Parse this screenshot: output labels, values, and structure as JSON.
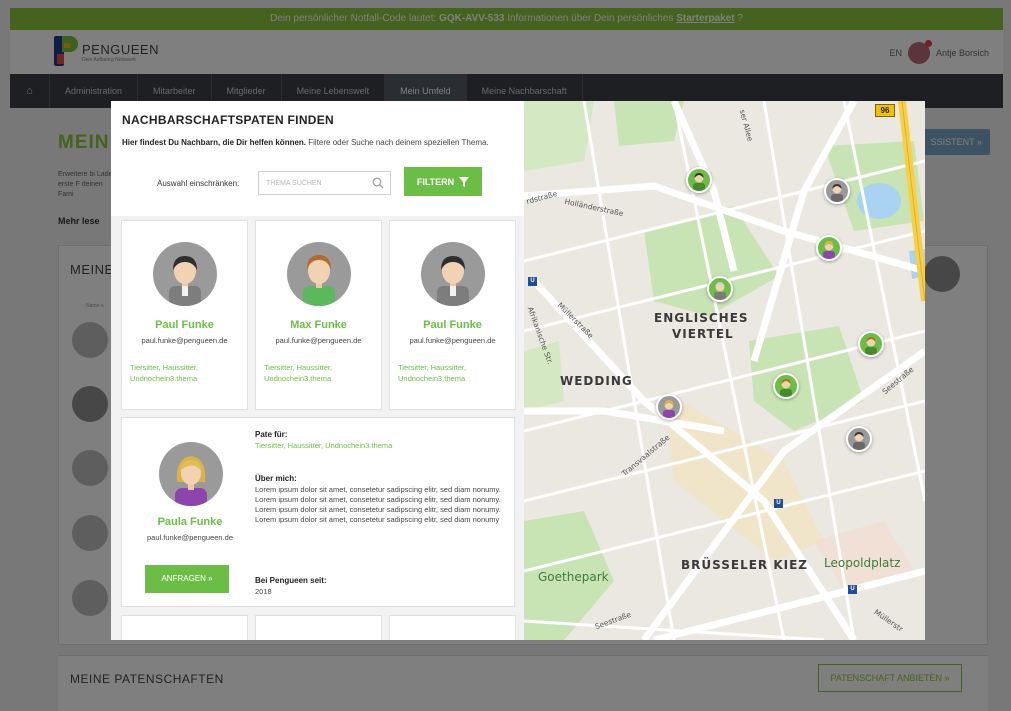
{
  "banner": {
    "prefix": "Dein persönlicher Notfall-Code lautet:",
    "code": "GQK-AVV-533",
    "middle": "Informationen über Dein persönliches",
    "link": "Starterpaket",
    "suffix": "?"
  },
  "brand": {
    "name": "PENGUEEN",
    "tagline": "Dein Aufbahrg Netzwerk"
  },
  "user": {
    "name": "Antje Borsich",
    "flag": "EN"
  },
  "nav": {
    "items": [
      "Administration",
      "Mitarbeiter",
      "Mitglieder",
      "Meine Lebenswelt",
      "Mein Umfeld",
      "Meine Nachbarschaft"
    ],
    "active": "Mein Umfeld"
  },
  "page": {
    "title": "MEIN U",
    "desc": "Erweitere bi Lade erste F deinen Fami",
    "read_more": "Mehr lese",
    "assistant_btn": "SSISTENT »",
    "section_title": "MEINE",
    "section_sub": "Name u",
    "patenschaften_title": "MEINE PATENSCHAFTEN",
    "patenschaften_btn": "PATENSCHAFT ANBIETEN »"
  },
  "modal": {
    "title": "NACHBARSCHAFTSPATEN FINDEN",
    "intro_bold": "Hier findest Du Nachbarn, die Dir helfen können.",
    "intro_rest": "Filtere oder Suche nach deinem speziellen Thema.",
    "filter_label": "Auswahl einschränken:",
    "search_placeholder": "THEMA SUCHEN",
    "filter_button": "FILTERN",
    "cards": [
      {
        "name": "Paul Funke",
        "email": "paul.funke@pengueen.de",
        "tags": "Tiersitter, Haussitter, Undnochein3.thema"
      },
      {
        "name": "Max Funke",
        "email": "paul.funke@pengueen.de",
        "tags": "Tiersitter, Haussitter, Undnochein3.thema"
      },
      {
        "name": "Paul Funke",
        "email": "paul.funke@pengueen.de",
        "tags": "Tiersitter, Haussitter, Undnochein3.thema"
      }
    ],
    "featured": {
      "name": "Paula Funke",
      "email": "paul.funke@pengueen.de",
      "request_button": "ANFRAGEN »",
      "pate_label": "Pate für:",
      "pate_tags": "Tiersitter, Haussitter, Undnochein3.thema",
      "about_label": "Über mich:",
      "about_text": "Lorem ipsum dolor sit amet, consetetur sadipscing elitr, sed diam nonumy. Lorem ipsum dolor sit amet, consetetur sadipscing elitr, sed diam nonumy. Lorem ipsum dolor sit amet, consetetur sadipscing elitr, sed diam nonumy. Lorem ipsum dolor sit amet, consetetur sadipscing elitr, sed diam nonumy",
      "since_label": "Bei Pengueen seit:",
      "since_value": "2018"
    }
  },
  "map": {
    "labels": {
      "allee": "ser Allee",
      "strasse_top": "rdstraße",
      "hollaender": "Holländerstraße",
      "mueller": "Müllerstraße",
      "afrikanische": "Afrikanische Str.",
      "englisches": "ENGLISCHES",
      "viertel": "VIERTEL",
      "wedding": "WEDDING",
      "transvaal": "Transvaalstraße",
      "bruesseler": "BRÜSSELER KIEZ",
      "leopoldplatz": "Leopoldplatz",
      "goethepark": "Goethepark",
      "seestrasse": "Seestraße",
      "seestrasse2": "Seestraße",
      "muellerstr2": "Müllerstr",
      "road_number": "96",
      "ubahn": "U"
    }
  },
  "colors": {
    "green": "#6cbd45",
    "nav": "#3a3f47",
    "banner": "#8cc53f"
  }
}
